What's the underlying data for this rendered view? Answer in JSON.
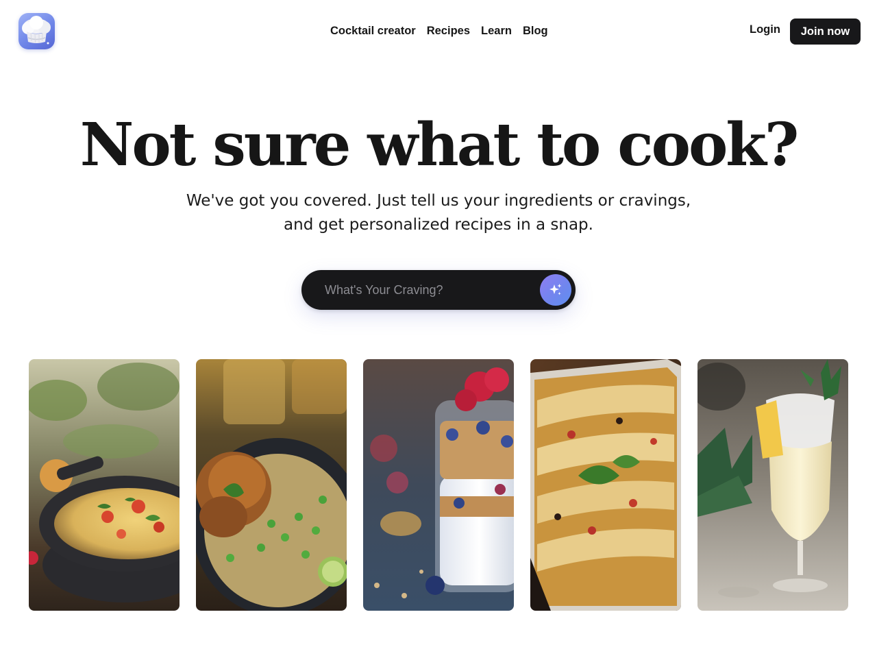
{
  "header": {
    "logo_icon": "chef-hat-icon",
    "nav": [
      {
        "label": "Cocktail creator"
      },
      {
        "label": "Recipes"
      },
      {
        "label": "Learn"
      },
      {
        "label": "Blog"
      }
    ],
    "login_label": "Login",
    "join_label": "Join now"
  },
  "hero": {
    "title": "Not sure what to cook?",
    "subtitle_line1": "We've got you covered. Just tell us your ingredients or cravings,",
    "subtitle_line2": "and get personalized recipes in a snap."
  },
  "search": {
    "placeholder": "What's Your Craving?",
    "value": "",
    "button_icon": "sparkle-icon"
  },
  "cards": [
    {
      "image": "frittata-skillet-photo"
    },
    {
      "image": "chicken-rice-pan-photo"
    },
    {
      "image": "yogurt-parfait-jar-photo"
    },
    {
      "image": "enchiladas-baking-dish-photo"
    },
    {
      "image": "pina-colada-cocktail-photo"
    }
  ],
  "colors": {
    "primary_dark": "#18181a",
    "accent_gradient_start": "#8f7df2",
    "accent_gradient_end": "#5f8ff0",
    "text": "#161616",
    "background": "#ffffff"
  }
}
